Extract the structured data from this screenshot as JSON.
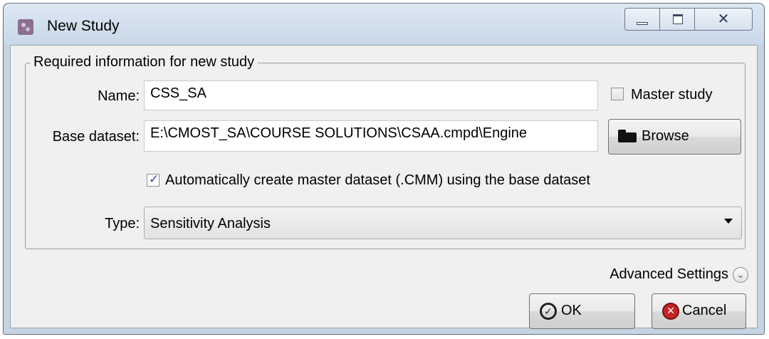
{
  "window": {
    "title": "New Study",
    "app_icon": "cmost-app-icon",
    "close_glyph": "✕"
  },
  "group": {
    "legend": "Required information for new study",
    "name_label": "Name:",
    "name_value": "CSS_SA",
    "master_study_label": "Master study",
    "master_study_checked": false,
    "base_dataset_label": "Base dataset:",
    "base_dataset_value": "E:\\CMOST_SA\\COURSE SOLUTIONS\\CSAA.cmpd\\Engine",
    "browse_label": "Browse",
    "browse_icon": "folder-icon",
    "auto_create_label": "Automatically create master dataset (.CMM) using the base dataset",
    "auto_create_checked": true,
    "type_label": "Type:",
    "type_value": "Sensitivity Analysis"
  },
  "footer": {
    "advanced_settings_label": "Advanced Settings",
    "advanced_icon": "chevron-down-icon",
    "ok_label": "OK",
    "ok_icon": "check-circle-icon",
    "cancel_label": "Cancel",
    "cancel_icon": "x-circle-icon"
  },
  "colors": {
    "window_frame": "#c6d3e2",
    "client_bg": "#f0f0f0",
    "check_accent": "#2a4bb0",
    "cancel_red": "#c52424"
  }
}
